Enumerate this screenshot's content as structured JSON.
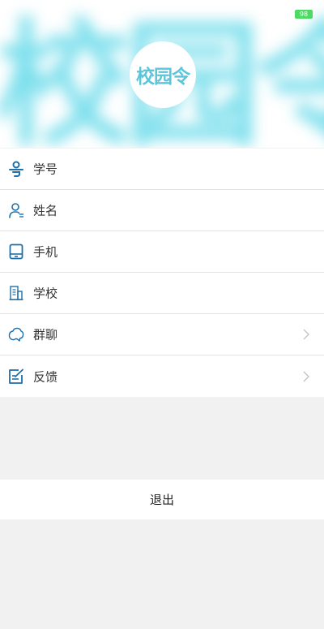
{
  "header": {
    "background_text": "校园令",
    "logo_text": "校园令",
    "battery": "98"
  },
  "menu": [
    {
      "label": "学号",
      "icon": "student-id-icon"
    },
    {
      "label": "姓名",
      "icon": "user-icon"
    },
    {
      "label": "手机",
      "icon": "phone-icon"
    },
    {
      "label": "学校",
      "icon": "school-icon"
    },
    {
      "label": "群聊",
      "icon": "group-chat-icon"
    },
    {
      "label": "反馈",
      "icon": "feedback-icon"
    }
  ],
  "logout": {
    "label": "退出"
  },
  "colors": {
    "accent": "#1f6fa8",
    "logo": "#5bc6da",
    "separator": "#e3e3e3",
    "background": "#f1f1f1"
  }
}
